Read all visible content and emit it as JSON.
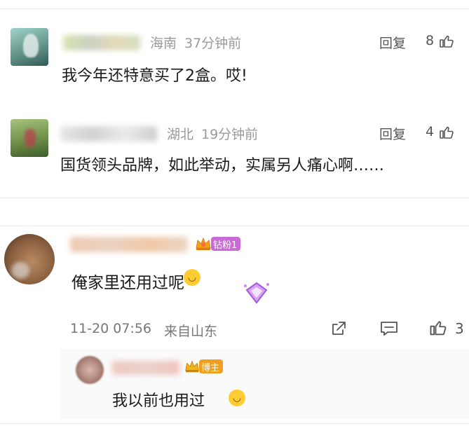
{
  "comment1": {
    "location": "海南",
    "time": "37分钟前",
    "text": "我今年还特意买了2盒。哎!",
    "reply_label": "回复",
    "likes": "8"
  },
  "comment2": {
    "location": "湖北",
    "time": "19分钟前",
    "text": "国货领头品牌，如此举动，实属另人痛心啊……",
    "reply_label": "回复",
    "likes": "4"
  },
  "comment3": {
    "badge": "钻粉1",
    "text": "俺家里还用过呢",
    "datetime": "11-20 07:56",
    "source": "来自山东",
    "likes": "3"
  },
  "reply1": {
    "badge": "博主",
    "text": "我以前也用过"
  },
  "colors": {
    "badge_fan": "#c96bd6",
    "badge_host": "#f0a020",
    "meta_gray": "#9a9a9a"
  }
}
